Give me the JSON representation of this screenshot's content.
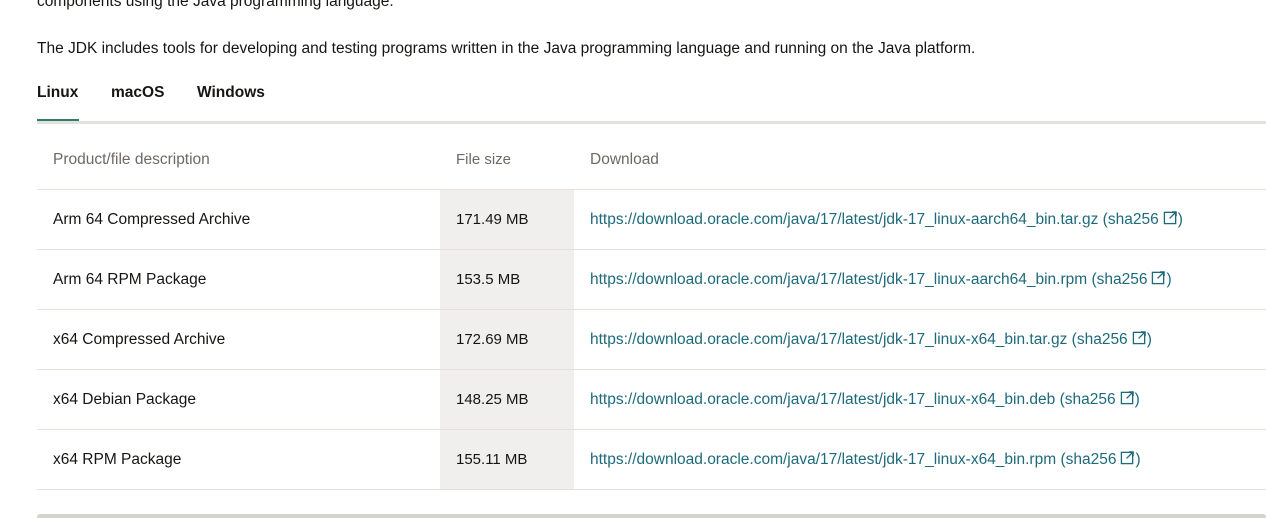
{
  "intro": {
    "line_cut": "components using the Java programming language.",
    "line": "The JDK includes tools for developing and testing programs written in the Java programming language and running on the Java platform."
  },
  "tabs": [
    {
      "label": "Linux",
      "active": true
    },
    {
      "label": "macOS",
      "active": false
    },
    {
      "label": "Windows",
      "active": false
    }
  ],
  "table": {
    "headers": {
      "desc": "Product/file description",
      "size": "File size",
      "download": "Download"
    },
    "rows": [
      {
        "desc": "Arm 64 Compressed Archive",
        "size": "171.49 MB",
        "url": "https://download.oracle.com/java/17/latest/jdk-17_linux-aarch64_bin.tar.gz",
        "sha": "sha256"
      },
      {
        "desc": "Arm 64 RPM Package",
        "size": "153.5 MB",
        "url": "https://download.oracle.com/java/17/latest/jdk-17_linux-aarch64_bin.rpm",
        "sha": "sha256"
      },
      {
        "desc": "x64 Compressed Archive",
        "size": "172.69 MB",
        "url": "https://download.oracle.com/java/17/latest/jdk-17_linux-x64_bin.tar.gz",
        "sha": "sha256"
      },
      {
        "desc": "x64 Debian Package",
        "size": "148.25 MB",
        "url": "https://download.oracle.com/java/17/latest/jdk-17_linux-x64_bin.deb",
        "sha": "sha256"
      },
      {
        "desc": "x64 RPM Package",
        "size": "155.11 MB",
        "url": "https://download.oracle.com/java/17/latest/jdk-17_linux-x64_bin.rpm",
        "sha": "sha256"
      }
    ]
  },
  "colors": {
    "link": "#1e6a7b",
    "tab_active": "#2e7d6f",
    "size_column_bg": "#f1efed",
    "rule": "#e4e1dd"
  },
  "icons": {
    "external": "external-link-icon"
  }
}
